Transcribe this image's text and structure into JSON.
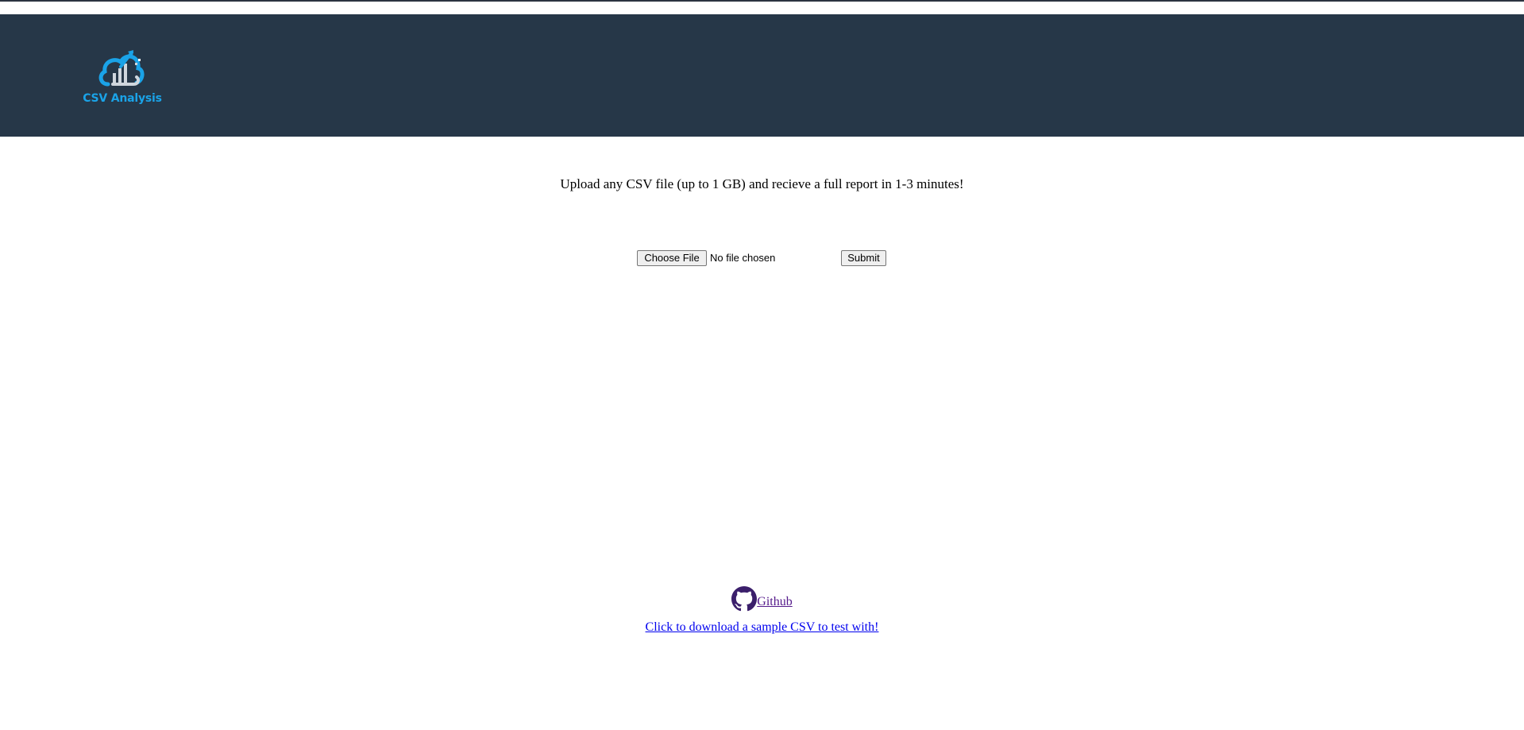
{
  "header": {
    "logo_text": "CSV Analysis",
    "brand_color": "#1aa3e8",
    "background_color": "#263748"
  },
  "main": {
    "tagline": "Upload any CSV file (up to 1 GB) and recieve a full report in 1-3 minutes!",
    "file_input": {
      "button_label": "Choose File",
      "status_text": "No file chosen"
    },
    "submit_label": "Submit"
  },
  "footer": {
    "github_icon": "github-icon",
    "github_label": "Github",
    "sample_link_label": "Click to download a sample CSV to test with!"
  }
}
